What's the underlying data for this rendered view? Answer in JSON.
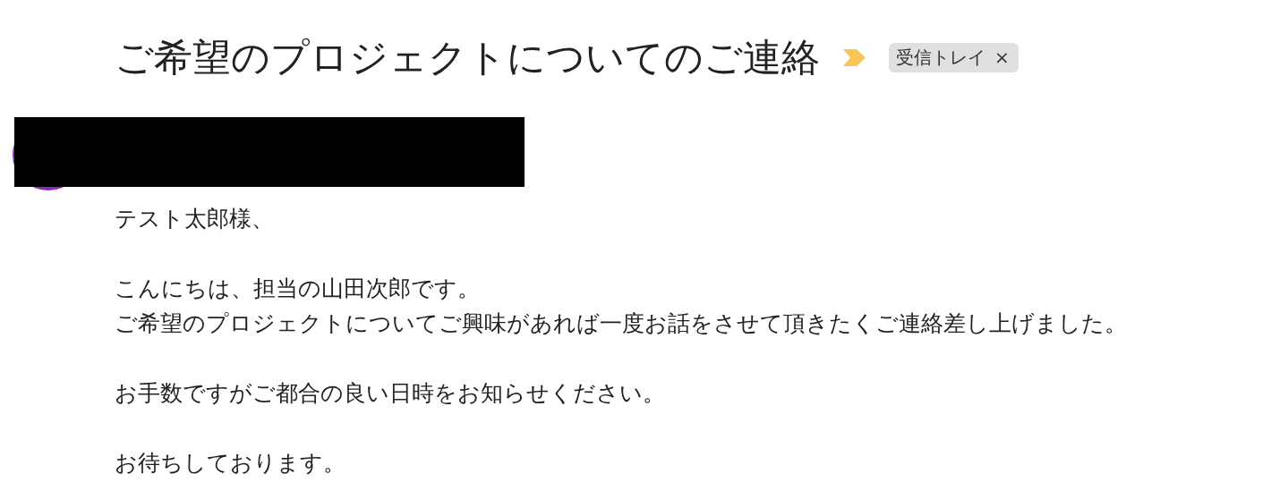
{
  "email": {
    "subject": "ご希望のプロジェクトについてのご連絡",
    "important": true,
    "label": {
      "text": "受信トレイ",
      "close": "×"
    }
  },
  "sender": {
    "redacted": true
  },
  "body": {
    "paragraphs": [
      [
        "テスト太郎様、"
      ],
      [
        "こんにちは、担当の山田次郎です。",
        "ご希望のプロジェクトについてご興味があれば一度お話をさせて頂きたくご連絡差し上げました。"
      ],
      [
        "お手数ですがご都合の良い日時をお知らせください。"
      ],
      [
        "お待ちしております。"
      ]
    ]
  }
}
